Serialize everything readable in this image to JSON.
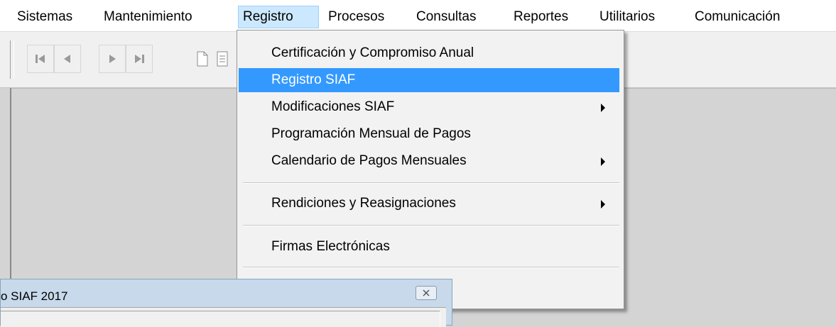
{
  "menubar": {
    "items": [
      {
        "label": "Sistemas"
      },
      {
        "label": "Mantenimiento"
      },
      {
        "label": "Registro"
      },
      {
        "label": "Procesos"
      },
      {
        "label": "Consultas"
      },
      {
        "label": "Reportes"
      },
      {
        "label": "Utilitarios"
      },
      {
        "label": "Comunicación"
      }
    ],
    "active": "Registro"
  },
  "toolbar": {
    "icons": [
      "first-record-icon",
      "previous-record-icon",
      "next-record-icon",
      "last-record-icon",
      "new-document-icon",
      "document-icon"
    ]
  },
  "dropdown": {
    "items": [
      {
        "label": "Certificación y Compromiso Anual"
      },
      {
        "label": "Registro SIAF",
        "highlighted": true
      },
      {
        "label": "Modificaciones SIAF",
        "submenu": true
      },
      {
        "label": "Programación Mensual de Pagos"
      },
      {
        "label": "Calendario de Pagos Mensuales",
        "submenu": true
      },
      {
        "label": "Rendiciones y Reasignaciones",
        "submenu": true
      },
      {
        "label": "Firmas Electrónicas"
      }
    ],
    "highlight_color": "#3399ff"
  },
  "dialog": {
    "title": "o SIAF 2017",
    "close_icon": "close-icon"
  }
}
